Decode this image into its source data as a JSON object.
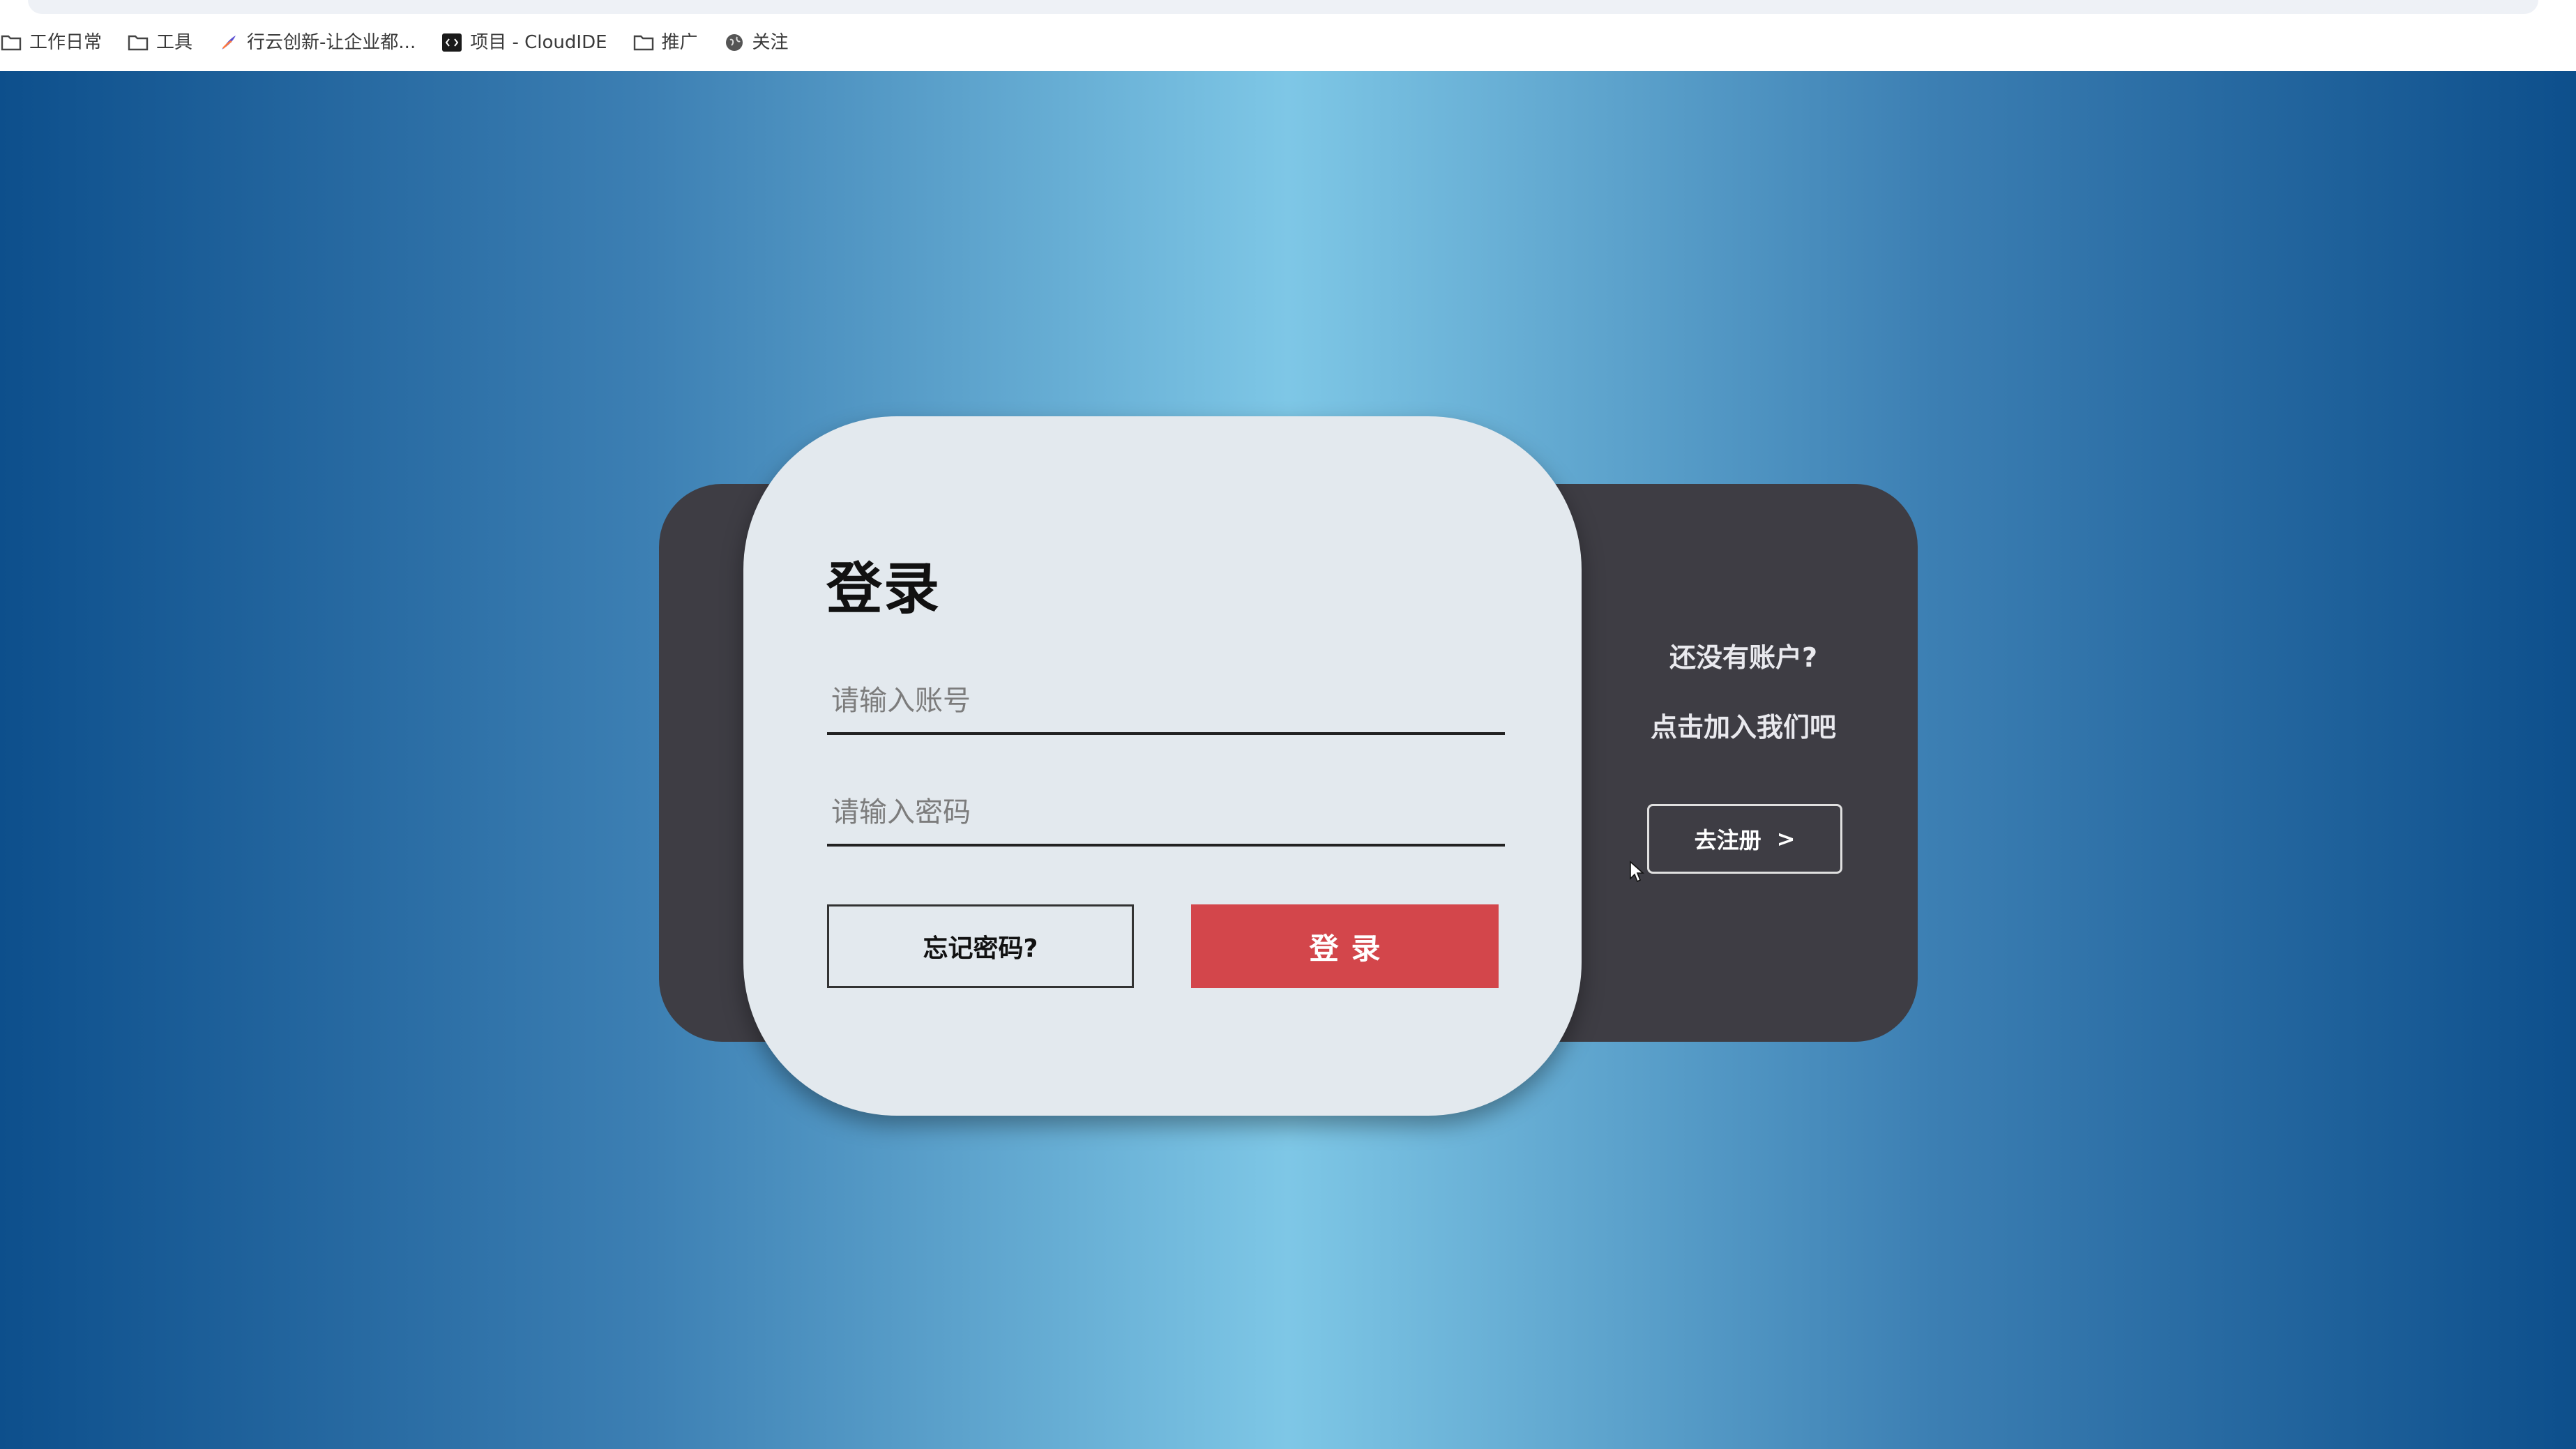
{
  "bookmarks": [
    {
      "label": "工作日常",
      "icon": "folder-icon"
    },
    {
      "label": "工具",
      "icon": "folder-icon"
    },
    {
      "label": "行云创新-让企业都...",
      "icon": "feather-logo-icon"
    },
    {
      "label": "项目 - CloudIDE",
      "icon": "code-logo-icon"
    },
    {
      "label": "推广",
      "icon": "folder-icon"
    },
    {
      "label": "关注",
      "icon": "globe-icon"
    }
  ],
  "login": {
    "title": "登录",
    "account_placeholder": "请输入账号",
    "password_placeholder": "请输入密码",
    "forgot_label": "忘记密码?",
    "login_label": "登录"
  },
  "register_panel": {
    "question": "还没有账户?",
    "invite": "点击加入我们吧",
    "register_label": "去注册",
    "register_arrow": ">"
  },
  "colors": {
    "accent_red": "#d3464b",
    "dark_panel": "#3e3d44",
    "card_bg": "#e3e9ee",
    "bg_edge_blue": "#0d4f8c",
    "bg_center_blue": "#7ec7e6"
  }
}
